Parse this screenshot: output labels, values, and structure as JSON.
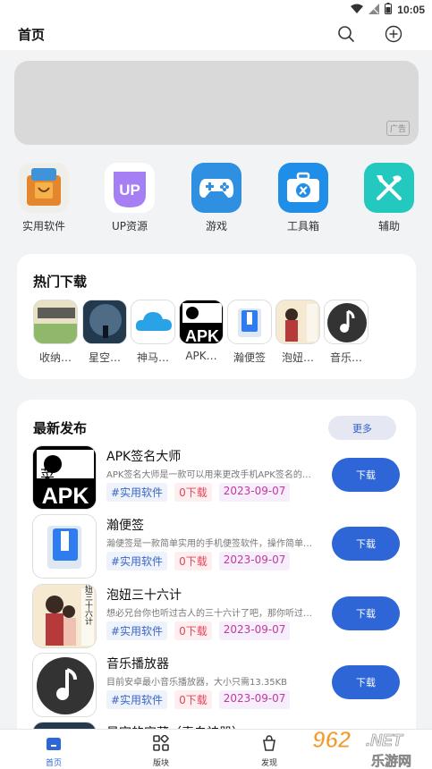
{
  "status": {
    "time": "10:05"
  },
  "appbar": {
    "title": "首页"
  },
  "banner": {
    "ad_label": "广告"
  },
  "categories": [
    {
      "label": "实用软件",
      "icon": "shopping-bag-icon",
      "color": "#d95f1a"
    },
    {
      "label": "UP资源",
      "icon": "up-badge-icon",
      "color": "#9c6ff0"
    },
    {
      "label": "游戏",
      "icon": "gamepad-icon",
      "color": "#2f8fe0"
    },
    {
      "label": "工具箱",
      "icon": "toolbox-icon",
      "color": "#1f8ee8"
    },
    {
      "label": "辅助",
      "icon": "tools-icon",
      "color": "#23c9bf"
    }
  ],
  "hot": {
    "title": "热门下载",
    "items": [
      {
        "label": "收纳…"
      },
      {
        "label": "星空…"
      },
      {
        "label": "神马…"
      },
      {
        "label": "APK…"
      },
      {
        "label": "瀚便签"
      },
      {
        "label": "泡妞…"
      },
      {
        "label": "音乐…"
      }
    ]
  },
  "latest": {
    "title": "最新发布",
    "more_label": "更多",
    "download_label": "下载",
    "apps": [
      {
        "name": "APK签名大师",
        "desc": "APK签名大师是一款可以用来更改手机APK签名的…",
        "category": "#实用软件",
        "count": "0下载",
        "date": "2023-09-07"
      },
      {
        "name": "瀚便签",
        "desc": "瀚便签是一款简单实用的手机便签软件，操作简单…",
        "category": "#实用软件",
        "count": "0下载",
        "date": "2023-09-07"
      },
      {
        "name": "泡妞三十六计",
        "desc": "想必兄台你也听过古人的三十六计了吧，那你听过…",
        "category": "#实用软件",
        "count": "0下载",
        "date": "2023-09-07"
      },
      {
        "name": "音乐播放器",
        "desc": "目前安卓最小音乐播放器，大小只需13.35KB",
        "category": "#实用软件",
        "count": "0下载",
        "date": "2023-09-07"
      },
      {
        "name": "星空的宝藏（表白神器）"
      }
    ]
  },
  "tabs": [
    {
      "label": "首页"
    },
    {
      "label": "版块"
    },
    {
      "label": "发现"
    }
  ],
  "watermark": {
    "top": "962",
    "net": ".NET",
    "bottom": "乐游网"
  },
  "apk_text": "APK",
  "apk_char": "菜",
  "paoniu_text": "泡妞三十六计",
  "up_text": "UP"
}
